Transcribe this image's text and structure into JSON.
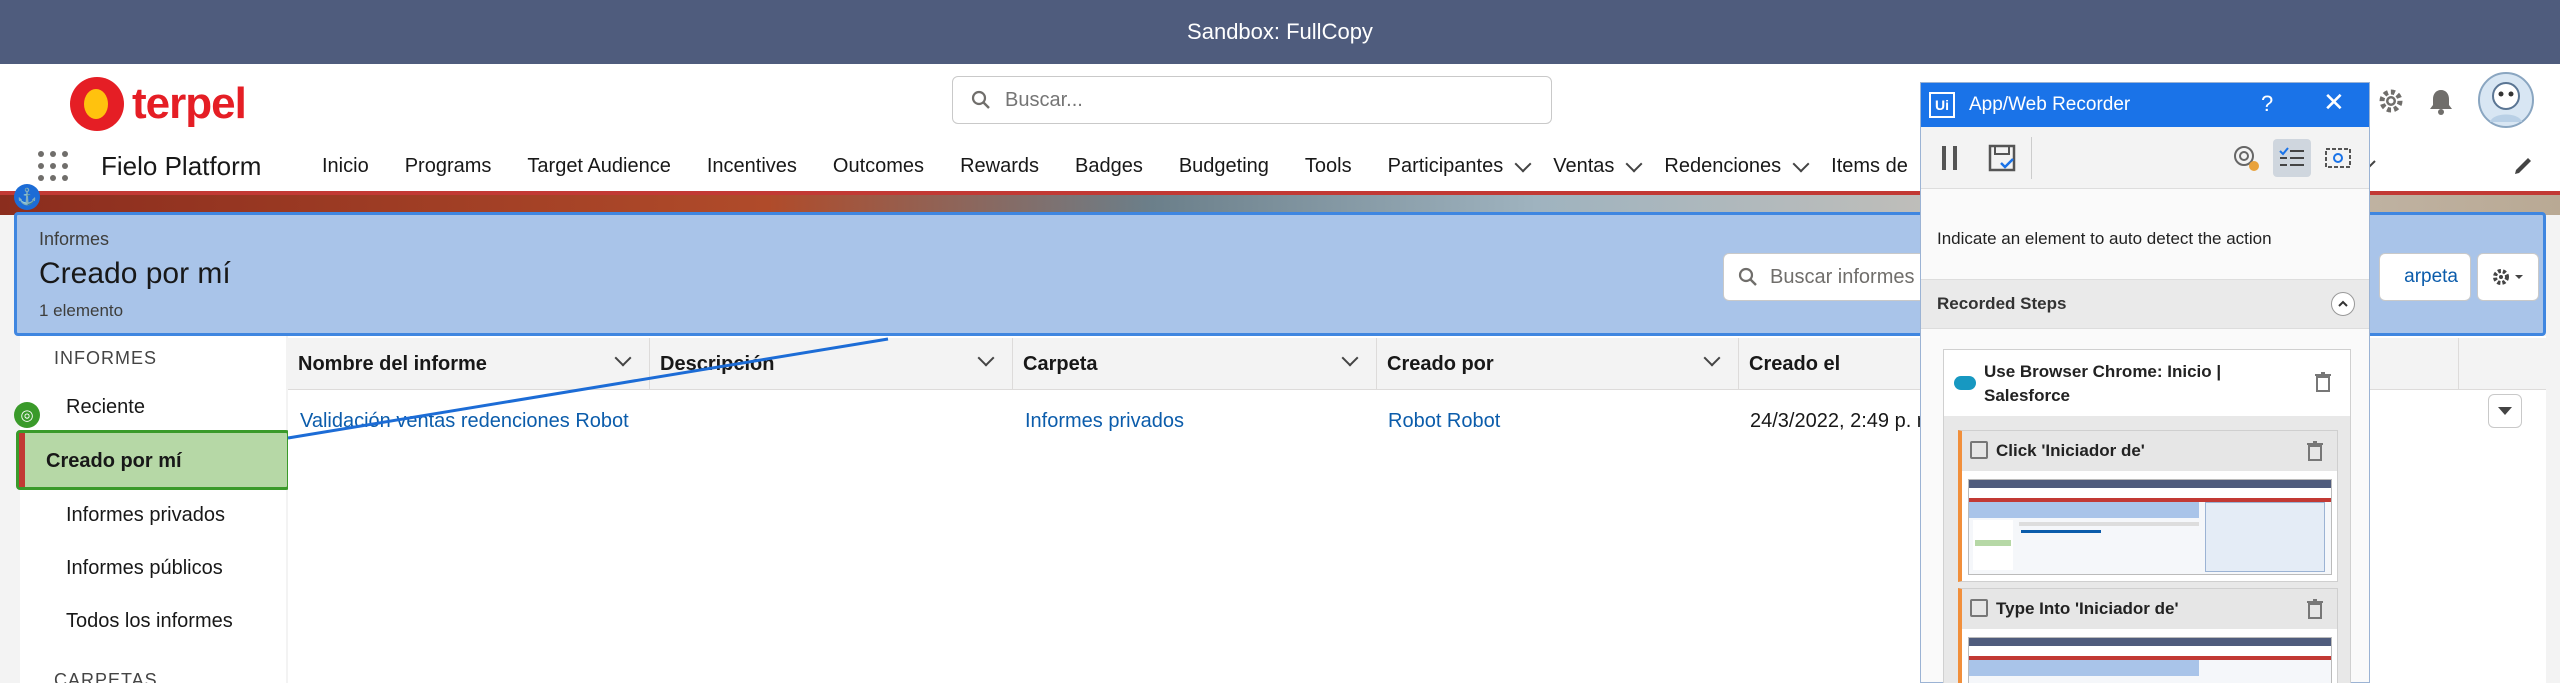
{
  "sandbox_bar": {
    "text": "Sandbox: FullCopy"
  },
  "header": {
    "logo_text": "terpel",
    "search_placeholder": "Buscar..."
  },
  "nav": {
    "app_name": "Fielo Platform",
    "items": [
      {
        "label": "Inicio",
        "dropdown": false
      },
      {
        "label": "Programs",
        "dropdown": false
      },
      {
        "label": "Target Audience",
        "dropdown": false
      },
      {
        "label": "Incentives",
        "dropdown": false
      },
      {
        "label": "Outcomes",
        "dropdown": false
      },
      {
        "label": "Rewards",
        "dropdown": false
      },
      {
        "label": "Badges",
        "dropdown": false
      },
      {
        "label": "Budgeting",
        "dropdown": false
      },
      {
        "label": "Tools",
        "dropdown": false
      },
      {
        "label": "Participantes",
        "dropdown": true
      },
      {
        "label": "Ventas",
        "dropdown": true
      },
      {
        "label": "Redenciones",
        "dropdown": true
      },
      {
        "label": "Items de",
        "dropdown": false
      }
    ]
  },
  "page_header": {
    "breadcrumb": "Informes",
    "title": "Creado por mí",
    "count": "1 elemento",
    "search_placeholder": "Buscar informes d",
    "folder_button": "arpeta"
  },
  "sidebar": {
    "heading": "INFORMES",
    "items": [
      "Reciente",
      "Creado por mí",
      "Informes privados",
      "Informes públicos",
      "Todos los informes"
    ],
    "selected": "Creado por mí",
    "next_heading": "CARPETAS"
  },
  "table": {
    "columns": [
      "Nombre del informe",
      "Descripción",
      "Carpeta",
      "Creado por",
      "Creado el"
    ],
    "rows": [
      {
        "name": "Validación ventas redenciones Robot",
        "description": "",
        "folder": "Informes privados",
        "created_by": "Robot Robot",
        "created_on": "24/3/2022, 2:49 p. m"
      }
    ]
  },
  "recorder": {
    "title": "App/Web Recorder",
    "help": "?",
    "close": "✕",
    "hint": "Indicate an element to auto detect the action",
    "steps_heading": "Recorded Steps",
    "step_container": "Use Browser Chrome: Inicio | Salesforce",
    "sub_steps": [
      "Click 'Iniciador de'",
      "Type Into 'Iniciador de'"
    ]
  },
  "colors": {
    "sandbox_bar": "#4f5c7d",
    "brand_red": "#e51e25",
    "brand_yellow": "#ffc20e",
    "link_blue": "#0b5cab",
    "highlight_blue": "#a9c4e9",
    "highlight_green": "#b6d8a6",
    "recorder_blue": "#1a73e8"
  }
}
